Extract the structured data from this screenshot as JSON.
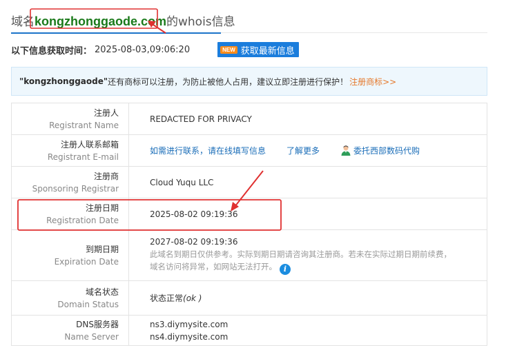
{
  "header": {
    "prefix": "域名",
    "domain": "kongzhonggaode.com",
    "suffix": "的whois信息"
  },
  "query_time": {
    "label": "以下信息获取时间：",
    "value": "2025-08-03,09:06:20"
  },
  "refresh": {
    "badge": "NEW",
    "label": "获取最新信息"
  },
  "notice": {
    "name": "\"kongzhonggaode\"",
    "text": " 还有商标可以注册，为防止被他人占用，建议立即注册进行保护！",
    "link": "注册商标>>"
  },
  "rows": {
    "registrant": {
      "zh": "注册人",
      "en": "Registrant Name",
      "value": "REDACTED FOR PRIVACY"
    },
    "email": {
      "zh": "注册人联系邮箱",
      "en": "Registrant E-mail",
      "contact_link": "如需进行联系，请在线填写信息",
      "more_link": "了解更多",
      "agent_link": "委托西部数码代购"
    },
    "registrar": {
      "zh": "注册商",
      "en": "Sponsoring Registrar",
      "value": "Cloud Yuqu LLC"
    },
    "reg_date": {
      "zh": "注册日期",
      "en": "Registration Date",
      "value": "2025-08-02 09:19:36"
    },
    "exp_date": {
      "zh": "到期日期",
      "en": "Expiration Date",
      "value": "2027-08-02 09:19:36",
      "note1": "此域名到期日仅供参考。实际到期日期请咨询其注册商。若未在实际过期日期前续费，",
      "note2": "域名访问将异常，如网站无法打开。"
    },
    "status": {
      "zh": "域名状态",
      "en": "Domain Status",
      "value": "状态正常",
      "code": "(ok )"
    },
    "dns": {
      "zh": "DNS服务器",
      "en": "Name Server",
      "ns1": "ns3.diymysite.com",
      "ns2": "ns4.diymysite.com"
    }
  },
  "colors": {
    "accent": "#1a73c9",
    "domain_green": "#1a7a1a",
    "annotation_red": "#e03030",
    "link_orange": "#e5782b"
  }
}
